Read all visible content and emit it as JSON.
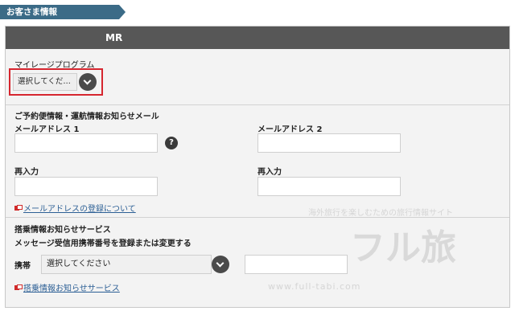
{
  "section": {
    "title": "お客さま情報"
  },
  "panel": {
    "header": "MR"
  },
  "mileage": {
    "label": "マイレージプログラム",
    "select_value": "選択してくだ…"
  },
  "email_section": {
    "heading": "ご予約便情報・運航情報お知らせメール",
    "email1_label": "メールアドレス 1",
    "email2_label": "メールアドレス 2",
    "reenter1_label": "再入力",
    "reenter2_label": "再入力",
    "help_symbol": "?",
    "link_label": "メールアドレスの登録について"
  },
  "boarding_section": {
    "heading": "搭乗情報お知らせサービス",
    "subheading": "メッセージ受信用携帯番号を登録または変更する",
    "mobile_label": "携帯",
    "mobile_select_value": "選択してください",
    "link_label": "搭乗情報お知らせサービス"
  },
  "watermark": {
    "tagline": "海外旅行を楽しむための旅行情報サイト",
    "brand": "フル旅",
    "url": "www.full-tabi.com"
  },
  "colors": {
    "tab": "#3b6b87",
    "header": "#575757",
    "highlight": "#d6262f",
    "link": "#2c5f95"
  },
  "icons": [
    "chevron-down-icon",
    "help-icon",
    "external-link-icon"
  ]
}
